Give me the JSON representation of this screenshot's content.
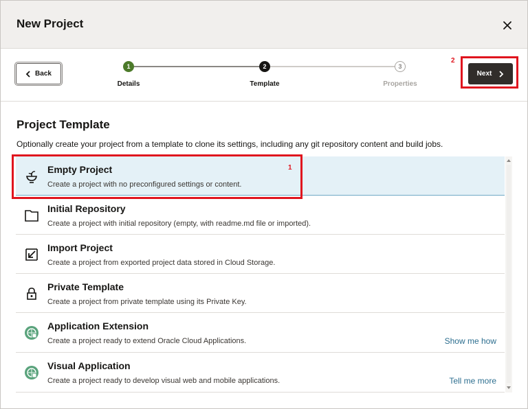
{
  "dialog": {
    "title": "New Project",
    "close_icon": "close-icon"
  },
  "toolbar": {
    "back_label": "Back",
    "next_label": "Next",
    "steps": [
      {
        "number": "1",
        "label": "Details",
        "state": "completed"
      },
      {
        "number": "2",
        "label": "Template",
        "state": "current"
      },
      {
        "number": "3",
        "label": "Properties",
        "state": "upcoming"
      }
    ]
  },
  "annotations": {
    "next_marker": "2",
    "template_marker": "1"
  },
  "section": {
    "title": "Project Template",
    "description": "Optionally create your project from a template to clone its settings, including any git repository content and build jobs."
  },
  "templates": [
    {
      "title": "Empty Project",
      "description": "Create a project with no preconfigured settings or content.",
      "icon": "sprout-bowl-icon",
      "selected": true,
      "link": ""
    },
    {
      "title": "Initial Repository",
      "description": "Create a project with initial repository (empty, with readme.md file or imported).",
      "icon": "folder-icon",
      "selected": false,
      "link": ""
    },
    {
      "title": "Import Project",
      "description": "Create a project from exported project data stored in Cloud Storage.",
      "icon": "import-arrow-icon",
      "selected": false,
      "link": ""
    },
    {
      "title": "Private Template",
      "description": "Create a project from private template using its Private Key.",
      "icon": "lock-icon",
      "selected": false,
      "link": ""
    },
    {
      "title": "Application Extension",
      "description": "Create a project ready to extend Oracle Cloud Applications.",
      "icon": "app-extension-icon",
      "selected": false,
      "link": "Show me how"
    },
    {
      "title": "Visual Application",
      "description": "Create a project ready to develop visual web and mobile applications.",
      "icon": "visual-app-icon",
      "selected": false,
      "link": "Tell me more"
    }
  ],
  "colors": {
    "accent_dark": "#312d2a",
    "step_completed": "#4c7a2a",
    "highlight_red": "#e0141e",
    "selected_row": "#e4f1f7",
    "link": "#2c6e8f"
  }
}
